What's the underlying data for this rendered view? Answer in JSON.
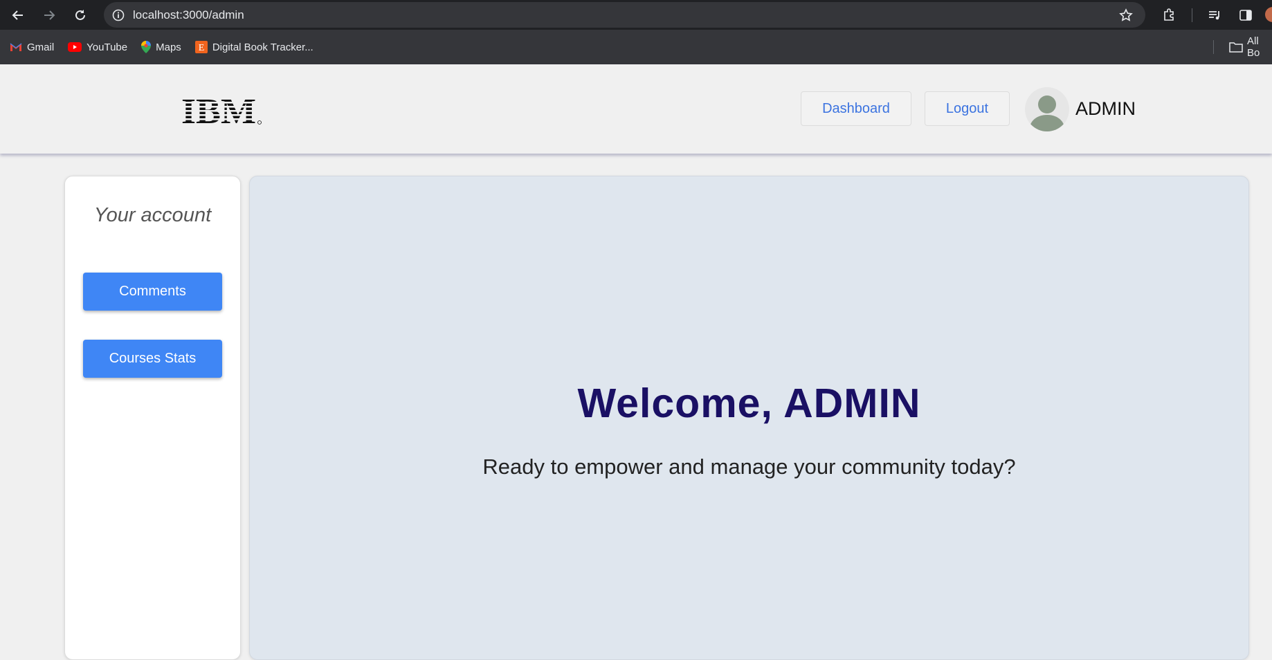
{
  "browser": {
    "url": "localhost:3000/admin",
    "bookmarks": [
      {
        "label": "Gmail",
        "icon": "gmail-icon"
      },
      {
        "label": "YouTube",
        "icon": "youtube-icon"
      },
      {
        "label": "Maps",
        "icon": "maps-icon"
      },
      {
        "label": "Digital Book Tracker...",
        "icon": "etsy-icon"
      }
    ],
    "all_bookmarks_label": "All Bo"
  },
  "header": {
    "logo_text": "IBM",
    "dashboard_label": "Dashboard",
    "logout_label": "Logout",
    "username": "ADMIN"
  },
  "sidebar": {
    "title": "Your account",
    "buttons": [
      {
        "label": "Comments"
      },
      {
        "label": "Courses Stats"
      }
    ]
  },
  "main": {
    "welcome": "Welcome, ADMIN",
    "tagline": "Ready to empower and manage your community today?"
  },
  "colors": {
    "primary_button": "#3f86f5",
    "link_blue": "#3b73e0",
    "welcome_text": "#1a1064",
    "panel_bg": "#dfe6ee"
  }
}
